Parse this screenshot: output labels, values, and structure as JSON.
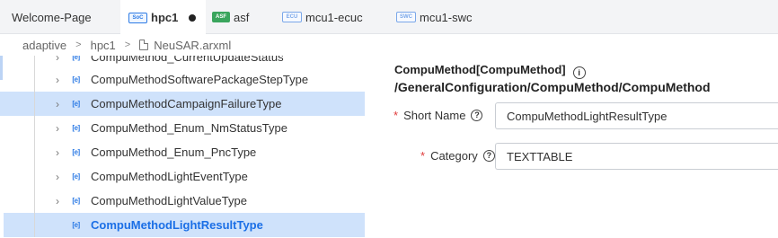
{
  "tabs": [
    {
      "label": "Welcome-Page",
      "badge": "",
      "active": false,
      "dirty": false
    },
    {
      "label": "hpc1",
      "badge": "SoC",
      "active": true,
      "dirty": true
    },
    {
      "label": "asf",
      "badge": "ASF",
      "active": false,
      "dirty": false
    },
    {
      "label": "mcu1-ecuc",
      "badge": "ECU",
      "active": false,
      "dirty": false
    },
    {
      "label": "mcu1-swc",
      "badge": "SWC",
      "active": false,
      "dirty": false
    }
  ],
  "breadcrumb": {
    "items": [
      "adaptive",
      "hpc1",
      "NeuSAR.arxml"
    ],
    "separator": ">"
  },
  "tree": {
    "rows": [
      {
        "label": "CompuMethod_CurrentUpdateStatus",
        "expandable": true
      },
      {
        "label": "CompuMethodSoftwarePackageStepType",
        "expandable": true
      },
      {
        "label": "CompuMethodCampaignFailureType",
        "expandable": true
      },
      {
        "label": "CompuMethod_Enum_NmStatusType",
        "expandable": true
      },
      {
        "label": "CompuMethod_Enum_PncType",
        "expandable": true
      },
      {
        "label": "CompuMethodLightEventType",
        "expandable": true
      },
      {
        "label": "CompuMethodLightValueType",
        "expandable": true
      },
      {
        "label": "CompuMethodLightResultType",
        "expandable": false
      }
    ],
    "icon_glyph": "[e]"
  },
  "panel": {
    "title": "CompuMethod[CompuMethod]",
    "info_glyph": "i",
    "path": "/GeneralConfiguration/CompuMethod/CompuMethod",
    "fields": [
      {
        "label": "Short Name",
        "required_mark": "*",
        "help_glyph": "?",
        "value": "CompuMethodLightResultType"
      },
      {
        "label": "Category",
        "required_mark": "*",
        "help_glyph": "?",
        "value": "TEXTTABLE"
      }
    ]
  },
  "colors": {
    "accent": "#1b6fe6",
    "selection": "#cfe2fb",
    "required": "#e03b3b",
    "tabbar_bg": "#f3f4f6"
  }
}
